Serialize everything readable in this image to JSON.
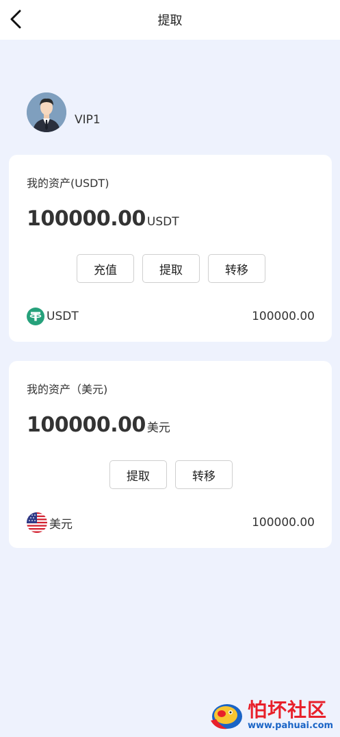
{
  "header": {
    "title": "提取",
    "back_icon": "chevron-left-icon"
  },
  "profile": {
    "avatar_icon": "user-avatar",
    "level": "VIP1"
  },
  "cards": [
    {
      "title": "我的资产(USDT)",
      "amount": "100000.00",
      "unit": "USDT",
      "buttons": [
        "充值",
        "提取",
        "转移"
      ],
      "asset": {
        "icon": "tether-icon",
        "name": "USDT",
        "value": "100000.00"
      }
    },
    {
      "title": "我的资产（美元)",
      "amount": "100000.00",
      "unit": "美元",
      "buttons": [
        "提取",
        "转移"
      ],
      "asset": {
        "icon": "us-flag-icon",
        "name": "美元",
        "value": "100000.00"
      }
    }
  ],
  "watermark": {
    "title": "怕坏社区",
    "url": "www.pahuai.com"
  },
  "colors": {
    "background": "#eef2fd",
    "card": "#ffffff",
    "tether": "#26a17b",
    "watermark_red": "#e8202a",
    "watermark_blue": "#1a64c6"
  }
}
